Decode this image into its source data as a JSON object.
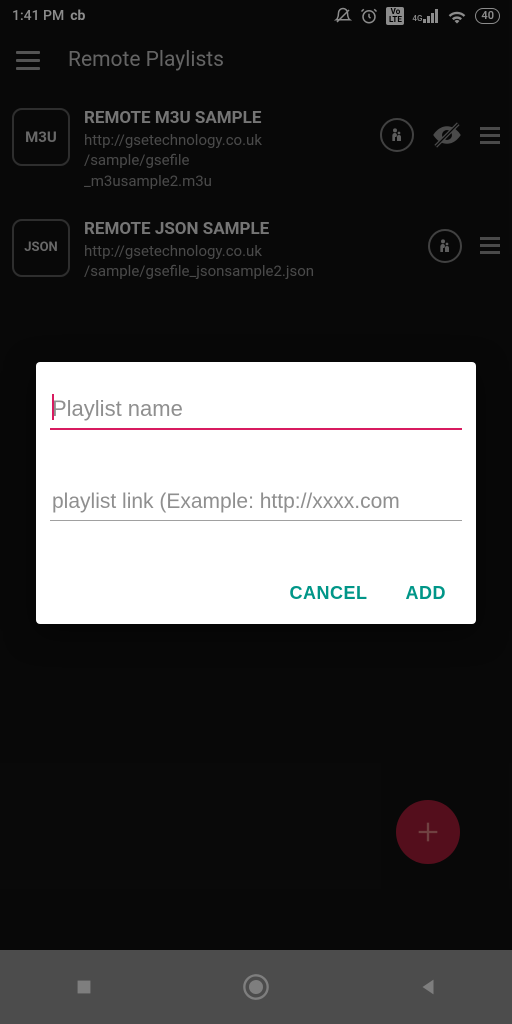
{
  "status": {
    "time": "1:41 PM",
    "carrier": "cb",
    "volte": "Vo LTE",
    "net": "4G",
    "battery": "40"
  },
  "header": {
    "title": "Remote Playlists"
  },
  "playlists": [
    {
      "badge": "M3U",
      "title": "REMOTE M3U SAMPLE",
      "url_l1": "http://gsetechnology.co.uk",
      "url_l2": "/sample/gsefile",
      "url_l3": "_m3usample2.m3u",
      "show_eye": true
    },
    {
      "badge": "JSON",
      "title": "REMOTE JSON SAMPLE",
      "url_l1": "http://gsetechnology.co.uk",
      "url_l2": "/sample/gsefile_jsonsample2.json",
      "url_l3": "",
      "show_eye": false
    }
  ],
  "dialog": {
    "name_placeholder": "Playlist name",
    "link_placeholder": "playlist link (Example: http://xxxx.com",
    "cancel": "CANCEL",
    "add": "ADD"
  }
}
